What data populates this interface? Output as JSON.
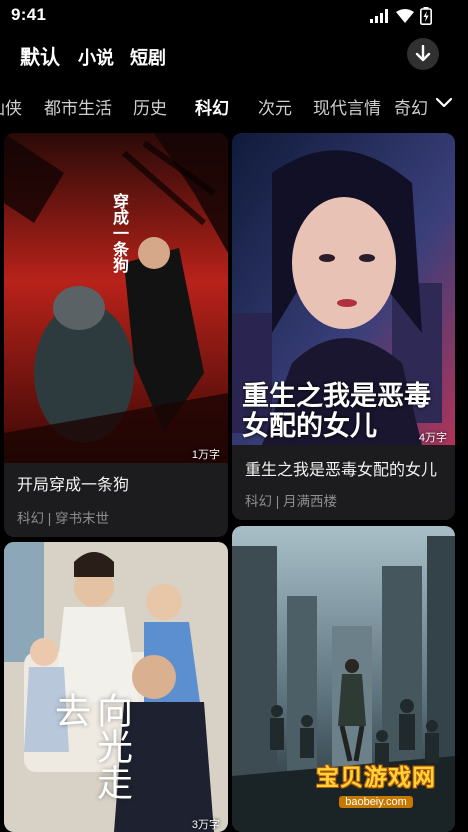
{
  "status_bar": {
    "time": "9:41"
  },
  "type_tabs": [
    "默认",
    "小说",
    "短剧"
  ],
  "categories": [
    "仙侠",
    "都市生活",
    "历史",
    "科幻",
    "次元",
    "现代言情",
    "奇幻"
  ],
  "active_category": "科幻",
  "books": [
    {
      "title": "开局穿成一条狗",
      "category": "科幻",
      "author": "穿书末世",
      "words": "1万字",
      "cover_text": "穿成一条狗"
    },
    {
      "title": "重生之我是恶毒女配的女儿",
      "category": "科幻",
      "author": "月满西楼",
      "words": "4万字",
      "cover_text": "重生之我是恶毒女配的女儿"
    },
    {
      "title": "",
      "category": "",
      "author": "",
      "words": "3万字",
      "cover_text": "向光走去"
    },
    {
      "title": "",
      "category": "",
      "author": "",
      "words": "",
      "cover_text": ""
    }
  ],
  "watermark": {
    "main": "宝贝游戏网",
    "sub": "baobeiy.com"
  },
  "colors": {
    "background": "#000000",
    "card": "#1c1c1e",
    "meta_text": "#8d8d8f",
    "watermark": "#ffd23a"
  }
}
